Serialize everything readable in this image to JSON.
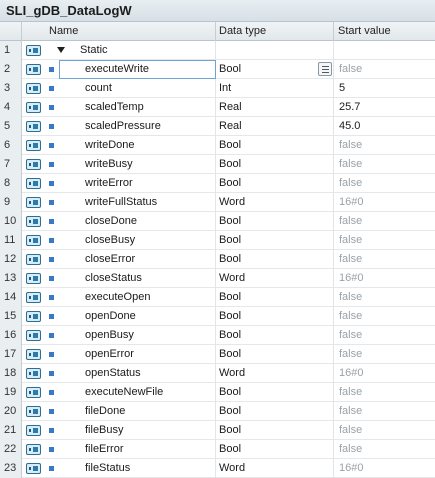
{
  "title": "SLI_gDB_DataLogW",
  "columns": {
    "name": "Name",
    "type": "Data type",
    "start": "Start value"
  },
  "section": {
    "num": "1",
    "label": "Static"
  },
  "rows": [
    {
      "num": "2",
      "name": "executeWrite",
      "type": "Bool",
      "start": "false",
      "default": true
    },
    {
      "num": "3",
      "name": "count",
      "type": "Int",
      "start": "5",
      "default": false
    },
    {
      "num": "4",
      "name": "scaledTemp",
      "type": "Real",
      "start": "25.7",
      "default": false
    },
    {
      "num": "5",
      "name": "scaledPressure",
      "type": "Real",
      "start": "45.0",
      "default": false
    },
    {
      "num": "6",
      "name": "writeDone",
      "type": "Bool",
      "start": "false",
      "default": true
    },
    {
      "num": "7",
      "name": "writeBusy",
      "type": "Bool",
      "start": "false",
      "default": true
    },
    {
      "num": "8",
      "name": "writeError",
      "type": "Bool",
      "start": "false",
      "default": true
    },
    {
      "num": "9",
      "name": "writeFullStatus",
      "type": "Word",
      "start": "16#0",
      "default": true
    },
    {
      "num": "10",
      "name": "closeDone",
      "type": "Bool",
      "start": "false",
      "default": true
    },
    {
      "num": "11",
      "name": "closeBusy",
      "type": "Bool",
      "start": "false",
      "default": true
    },
    {
      "num": "12",
      "name": "closeError",
      "type": "Bool",
      "start": "false",
      "default": true
    },
    {
      "num": "13",
      "name": "closeStatus",
      "type": "Word",
      "start": "16#0",
      "default": true
    },
    {
      "num": "14",
      "name": "executeOpen",
      "type": "Bool",
      "start": "false",
      "default": true
    },
    {
      "num": "15",
      "name": "openDone",
      "type": "Bool",
      "start": "false",
      "default": true
    },
    {
      "num": "16",
      "name": "openBusy",
      "type": "Bool",
      "start": "false",
      "default": true
    },
    {
      "num": "17",
      "name": "openError",
      "type": "Bool",
      "start": "false",
      "default": true
    },
    {
      "num": "18",
      "name": "openStatus",
      "type": "Word",
      "start": "16#0",
      "default": true
    },
    {
      "num": "19",
      "name": "executeNewFile",
      "type": "Bool",
      "start": "false",
      "default": true
    },
    {
      "num": "20",
      "name": "fileDone",
      "type": "Bool",
      "start": "false",
      "default": true
    },
    {
      "num": "21",
      "name": "fileBusy",
      "type": "Bool",
      "start": "false",
      "default": true
    },
    {
      "num": "22",
      "name": "fileError",
      "type": "Bool",
      "start": "false",
      "default": true
    },
    {
      "num": "23",
      "name": "fileStatus",
      "type": "Word",
      "start": "16#0",
      "default": true
    }
  ],
  "icons": {
    "interface": "db-interface-icon",
    "member": "member-square-icon",
    "expand": "expand-triangle-icon",
    "dropdown": "datatype-dropdown-icon"
  },
  "colors": {
    "default_value": "#9aa3a9",
    "member_square": "#3a79c6",
    "selection": "#6ea3d6"
  }
}
